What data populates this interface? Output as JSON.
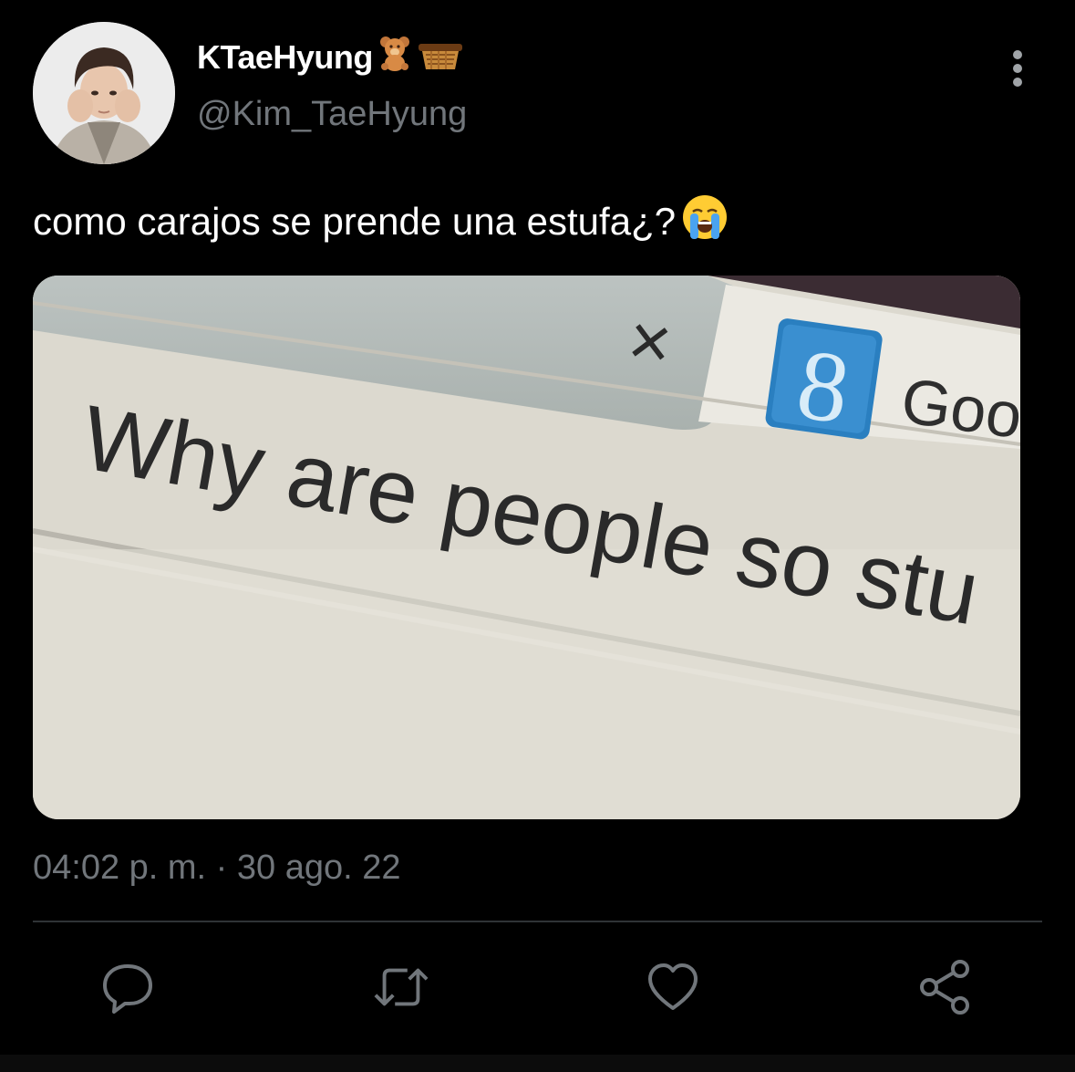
{
  "tweet": {
    "display_name": "KTaeHyung",
    "name_emojis": [
      "teddy-bear-icon",
      "basket-icon"
    ],
    "handle": "@Kim_TaeHyung",
    "text": "como carajos se prende una estufa¿?",
    "text_emoji": "crying-face-icon",
    "timestamp": "04:02 p. m. · 30 ago. 22"
  },
  "media": {
    "search_text": "Why are people so stu",
    "tab_label": "Goo",
    "close_glyph": "×",
    "google_glyph": "8"
  },
  "actions": [
    "reply-icon",
    "retweet-icon",
    "like-icon",
    "share-icon"
  ],
  "colors": {
    "background": "#000000",
    "text_primary": "#ffffff",
    "text_secondary": "#71767b",
    "divider": "#2f3336"
  }
}
